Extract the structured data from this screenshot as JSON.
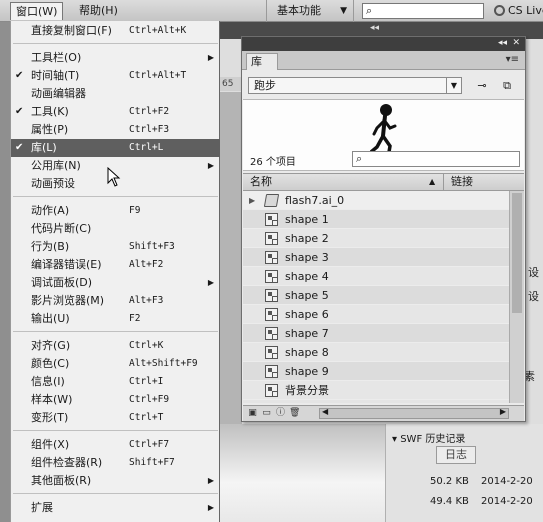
{
  "menubar": {
    "window": "窗口(W)",
    "help": "帮助(H)"
  },
  "workspace": {
    "label": "基本功能"
  },
  "cslive": {
    "label": "CS Live"
  },
  "menu_items": [
    {
      "label": "直接复制窗口(F)",
      "shortcut": "Ctrl+Alt+K",
      "checked": false,
      "submenu": false
    },
    {
      "label": "工具栏(O)",
      "shortcut": "",
      "checked": false,
      "submenu": true
    },
    {
      "label": "时间轴(T)",
      "shortcut": "Ctrl+Alt+T",
      "checked": true,
      "submenu": false
    },
    {
      "label": "动画编辑器",
      "shortcut": "",
      "checked": false,
      "submenu": false
    },
    {
      "label": "工具(K)",
      "shortcut": "Ctrl+F2",
      "checked": true,
      "submenu": false
    },
    {
      "label": "属性(P)",
      "shortcut": "Ctrl+F3",
      "checked": false,
      "submenu": false
    },
    {
      "label": "库(L)",
      "shortcut": "Ctrl+L",
      "checked": true,
      "submenu": false,
      "highlighted": true
    },
    {
      "label": "公用库(N)",
      "shortcut": "",
      "checked": false,
      "submenu": true
    },
    {
      "label": "动画预设",
      "shortcut": "",
      "checked": false,
      "submenu": false
    },
    {
      "label": "动作(A)",
      "shortcut": "F9",
      "checked": false,
      "submenu": false
    },
    {
      "label": "代码片断(C)",
      "shortcut": "",
      "checked": false,
      "submenu": false
    },
    {
      "label": "行为(B)",
      "shortcut": "Shift+F3",
      "checked": false,
      "submenu": false
    },
    {
      "label": "编译器错误(E)",
      "shortcut": "Alt+F2",
      "checked": false,
      "submenu": false
    },
    {
      "label": "调试面板(D)",
      "shortcut": "",
      "checked": false,
      "submenu": true
    },
    {
      "label": "影片浏览器(M)",
      "shortcut": "Alt+F3",
      "checked": false,
      "submenu": false
    },
    {
      "label": "输出(U)",
      "shortcut": "F2",
      "checked": false,
      "submenu": false
    },
    {
      "label": "对齐(G)",
      "shortcut": "Ctrl+K",
      "checked": false,
      "submenu": false
    },
    {
      "label": "颜色(C)",
      "shortcut": "Alt+Shift+F9",
      "checked": false,
      "submenu": false
    },
    {
      "label": "信息(I)",
      "shortcut": "Ctrl+I",
      "checked": false,
      "submenu": false
    },
    {
      "label": "样本(W)",
      "shortcut": "Ctrl+F9",
      "checked": false,
      "submenu": false
    },
    {
      "label": "变形(T)",
      "shortcut": "Ctrl+T",
      "checked": false,
      "submenu": false
    },
    {
      "label": "组件(X)",
      "shortcut": "Ctrl+F7",
      "checked": false,
      "submenu": false
    },
    {
      "label": "组件检查器(R)",
      "shortcut": "Shift+F7",
      "checked": false,
      "submenu": false
    },
    {
      "label": "其他面板(R)",
      "shortcut": "",
      "checked": false,
      "submenu": true
    },
    {
      "label": "扩展",
      "shortcut": "",
      "checked": false,
      "submenu": true
    }
  ],
  "library": {
    "tab": "库",
    "document": "跑步",
    "item_count": "26 个项目",
    "col_name": "名称",
    "col_linkage": "链接",
    "items": [
      {
        "name": "flash7.ai_0",
        "type": "folder"
      },
      {
        "name": "shape 1",
        "type": "symbol"
      },
      {
        "name": "shape 2",
        "type": "symbol"
      },
      {
        "name": "shape 3",
        "type": "symbol"
      },
      {
        "name": "shape 4",
        "type": "symbol"
      },
      {
        "name": "shape 5",
        "type": "symbol"
      },
      {
        "name": "shape 6",
        "type": "symbol"
      },
      {
        "name": "shape 7",
        "type": "symbol"
      },
      {
        "name": "shape 8",
        "type": "symbol"
      },
      {
        "name": "shape 9",
        "type": "symbol"
      },
      {
        "name": "背景分景",
        "type": "symbol"
      }
    ]
  },
  "background": {
    "strip_text": "65",
    "side_labels": [
      "设",
      "设",
      "素"
    ],
    "swf_history_title": "SWF 历史记录",
    "log_button": "日志",
    "history": [
      {
        "size": "50.2 KB",
        "date": "2014-2-20"
      },
      {
        "size": "49.4 KB",
        "date": "2014-2-20"
      }
    ]
  }
}
